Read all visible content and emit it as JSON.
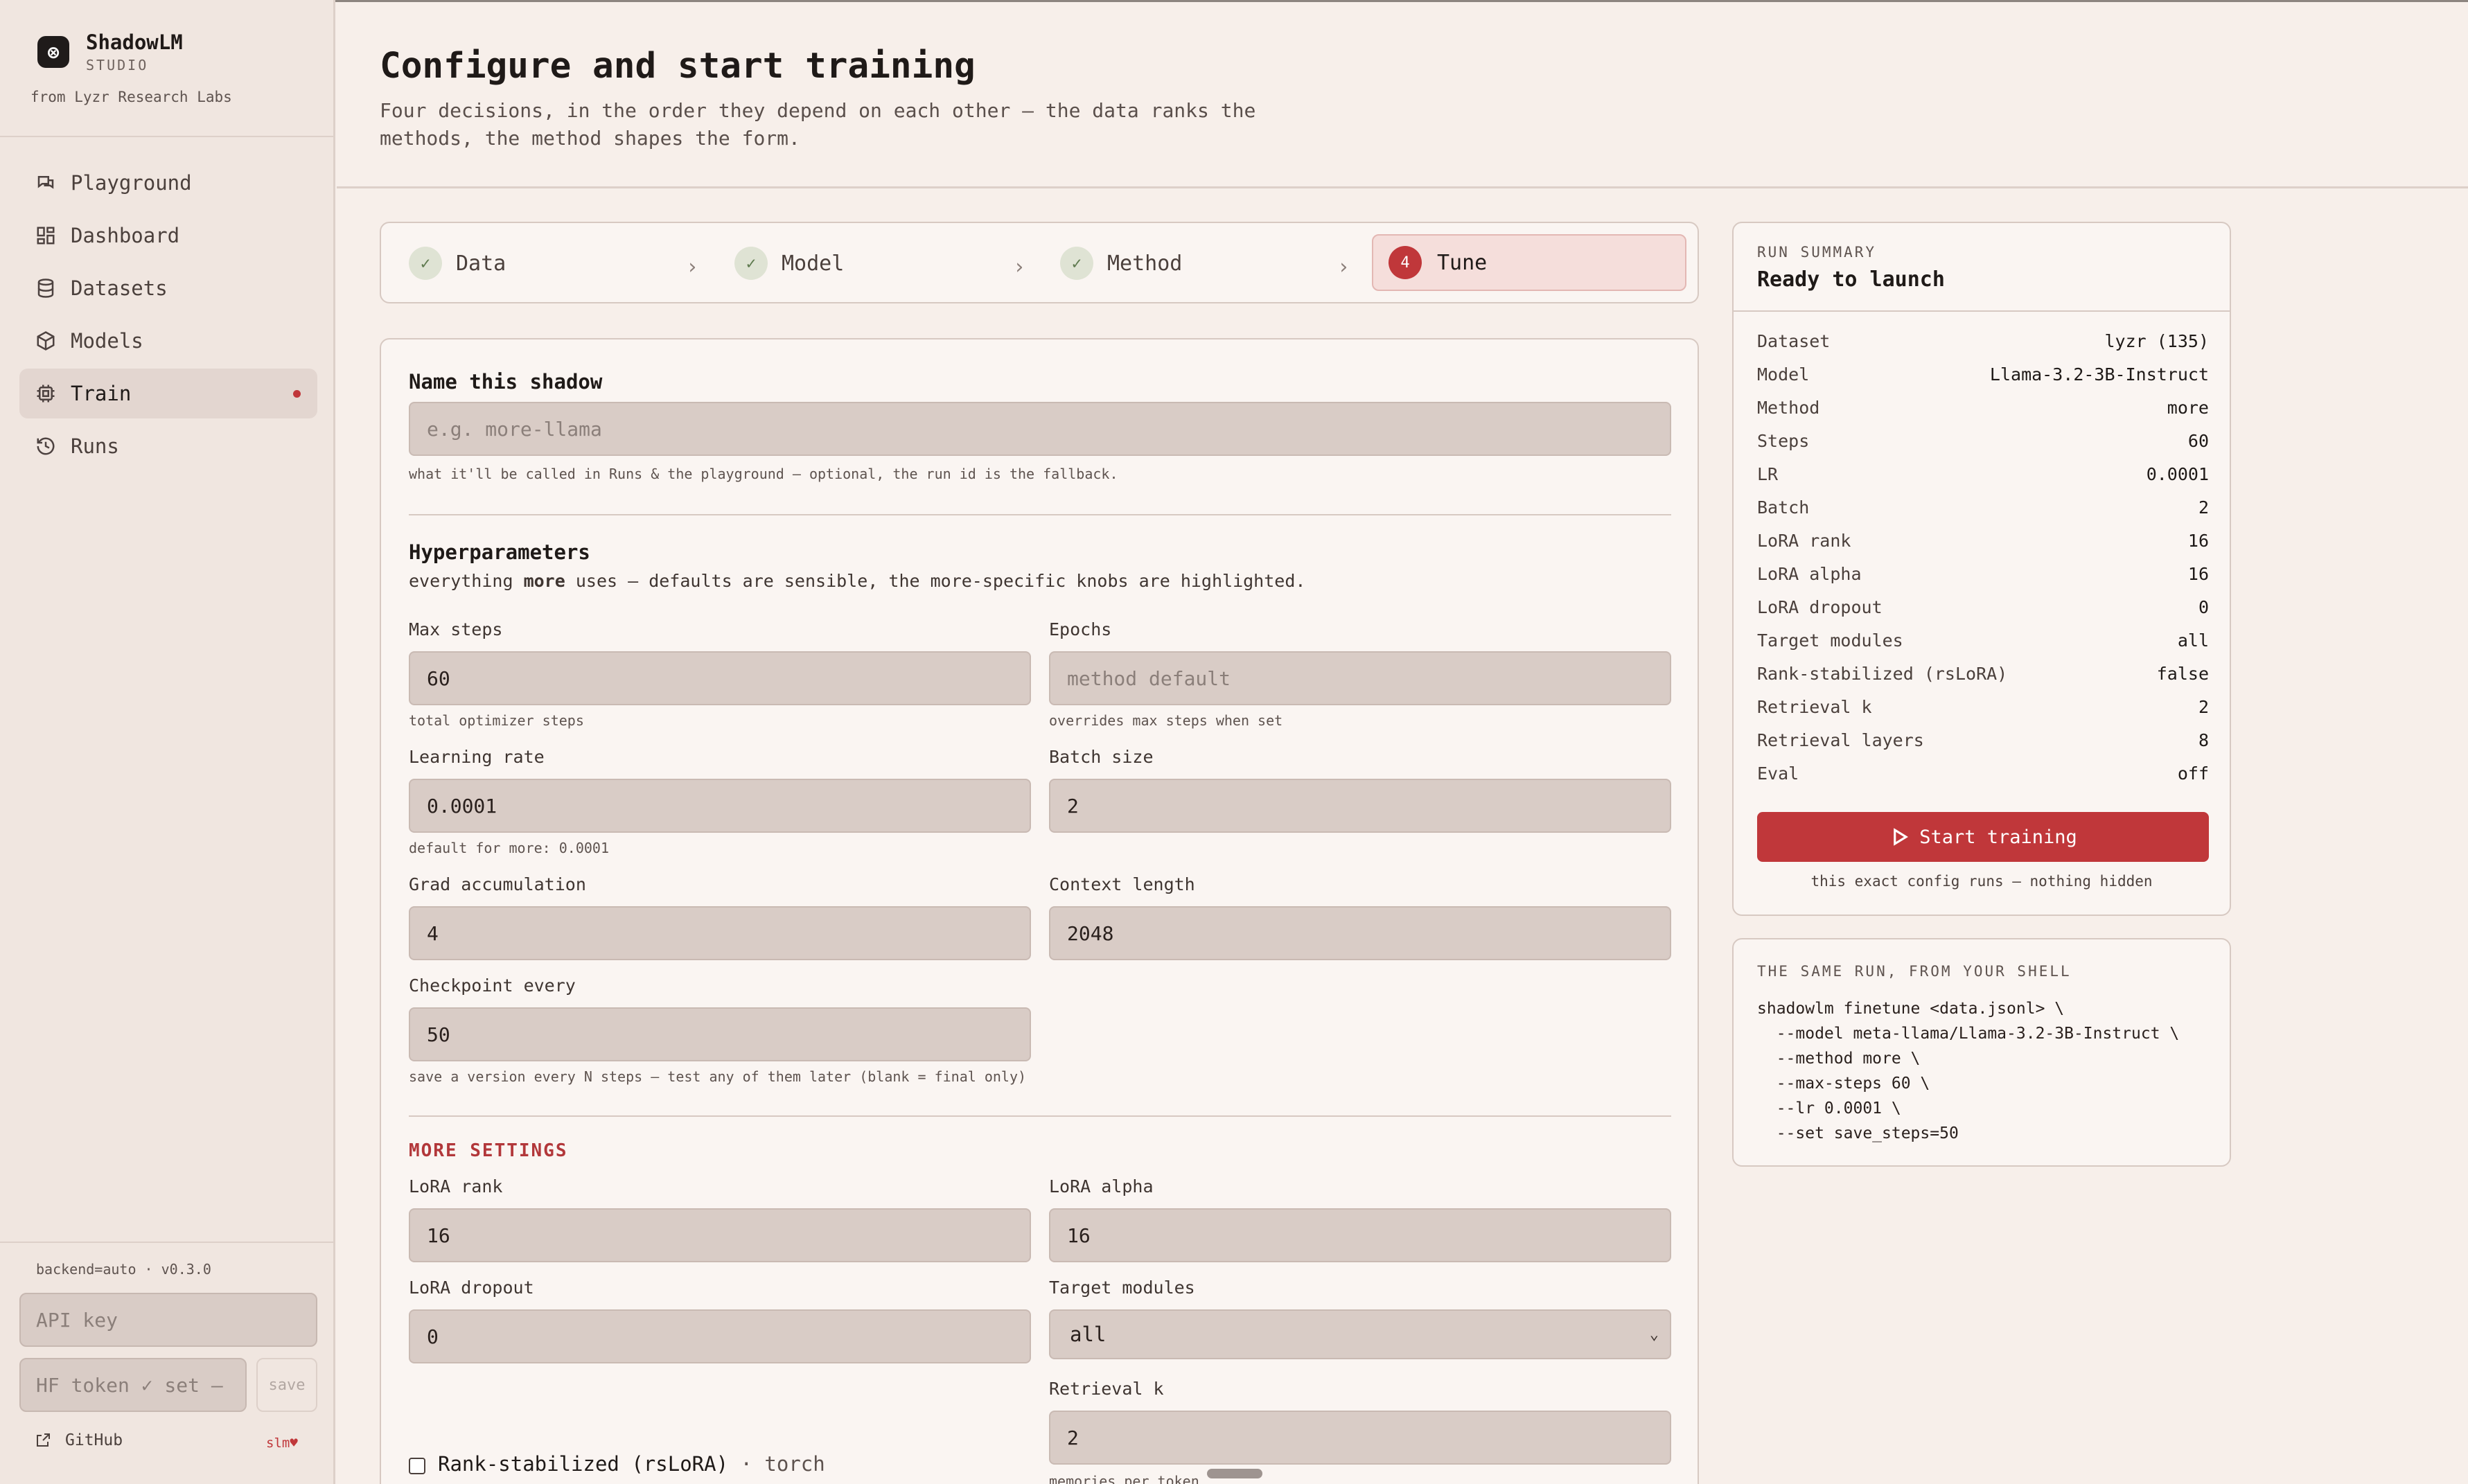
{
  "app": {
    "name": "ShadowLM",
    "subtitle": "STUDIO",
    "from": "from Lyzr Research Labs",
    "logo_glyph": "⊗"
  },
  "sidebar": {
    "items": [
      {
        "label": "Playground",
        "icon": "chat-icon"
      },
      {
        "label": "Dashboard",
        "icon": "dashboard-icon"
      },
      {
        "label": "Datasets",
        "icon": "database-icon"
      },
      {
        "label": "Models",
        "icon": "cube-icon"
      },
      {
        "label": "Train",
        "icon": "chip-icon",
        "active": true
      },
      {
        "label": "Runs",
        "icon": "history-icon"
      }
    ],
    "backend": "backend=auto · v0.3.0",
    "api_key_placeholder": "API key",
    "hf_token_placeholder": "HF token ✓ set — ",
    "save_label": "save",
    "github_label": "GitHub",
    "slm_label": "slm♥"
  },
  "header": {
    "title": "Configure and start training",
    "subtitle": "Four decisions, in the order they depend on each other — the data ranks the methods, the method shapes the form."
  },
  "stepper": {
    "steps": [
      {
        "label": "Data",
        "done": true
      },
      {
        "label": "Model",
        "done": true
      },
      {
        "label": "Method",
        "done": true
      },
      {
        "label": "Tune",
        "number": "4",
        "active": true
      }
    ],
    "check_glyph": "✓",
    "chevron_glyph": "›"
  },
  "form": {
    "name_title": "Name this shadow",
    "name_placeholder": "e.g. more-llama",
    "name_hint": "what it'll be called in Runs & the playground — optional, the run id is the fallback.",
    "hyper_title": "Hyperparameters",
    "hyper_desc_pre": "everything ",
    "hyper_desc_bold": "more",
    "hyper_desc_post": " uses — defaults are sensible, the more-specific knobs are highlighted.",
    "max_steps": {
      "label": "Max steps",
      "value": "60",
      "hint": "total optimizer steps"
    },
    "epochs": {
      "label": "Epochs",
      "placeholder": "method default",
      "hint": "overrides max steps when set"
    },
    "learning_rate": {
      "label": "Learning rate",
      "value": "0.0001",
      "hint": "default for more: 0.0001"
    },
    "batch_size": {
      "label": "Batch size",
      "value": "2"
    },
    "grad_accum": {
      "label": "Grad accumulation",
      "value": "4"
    },
    "context_length": {
      "label": "Context length",
      "value": "2048"
    },
    "checkpoint": {
      "label": "Checkpoint every",
      "value": "50",
      "hint": "save a version every N steps — test any of them later (blank = final only)"
    },
    "more_title": "MORE SETTINGS",
    "lora_rank": {
      "label": "LoRA rank",
      "value": "16"
    },
    "lora_alpha": {
      "label": "LoRA alpha",
      "value": "16"
    },
    "lora_dropout": {
      "label": "LoRA dropout",
      "value": "0"
    },
    "target_modules": {
      "label": "Target modules",
      "value": "all",
      "chevron": "⌄"
    },
    "retrieval_k": {
      "label": "Retrieval k",
      "value": "2",
      "hint": "memories per token"
    },
    "rslora": {
      "label": "Rank-stabilized (rsLoRA)",
      "suffix": " · torch",
      "checked": false
    }
  },
  "summary": {
    "kicker": "RUN SUMMARY",
    "title": "Ready to launch",
    "rows": [
      {
        "key": "Dataset",
        "value": "lyzr (135)"
      },
      {
        "key": "Model",
        "value": "Llama-3.2-3B-Instruct"
      },
      {
        "key": "Method",
        "value": "more"
      },
      {
        "key": "Steps",
        "value": "60"
      },
      {
        "key": "LR",
        "value": "0.0001"
      },
      {
        "key": "Batch",
        "value": "2"
      },
      {
        "key": "LoRA rank",
        "value": "16"
      },
      {
        "key": "LoRA alpha",
        "value": "16"
      },
      {
        "key": "LoRA dropout",
        "value": "0"
      },
      {
        "key": "Target modules",
        "value": "all"
      },
      {
        "key": "Rank-stabilized (rsLoRA)",
        "value": "false"
      },
      {
        "key": "Retrieval k",
        "value": "2"
      },
      {
        "key": "Retrieval layers",
        "value": "8"
      },
      {
        "key": "Eval",
        "value": "off"
      }
    ],
    "start_label": "Start training",
    "note": "this exact config runs — nothing hidden"
  },
  "shell": {
    "kicker": "THE SAME RUN, FROM YOUR SHELL",
    "lines": [
      "shadowlm finetune <data.jsonl> \\",
      "  --model meta-llama/Llama-3.2-3B-Instruct \\",
      "  --method more \\",
      "  --max-steps 60 \\",
      "  --lr 0.0001 \\",
      "  --set save_steps=50"
    ]
  },
  "colors": {
    "accent": "#c0373a",
    "background": "#f7efea",
    "sidebar": "#f0e6e0",
    "input": "#d9ccc6",
    "check_bg": "#dfe3d4"
  }
}
